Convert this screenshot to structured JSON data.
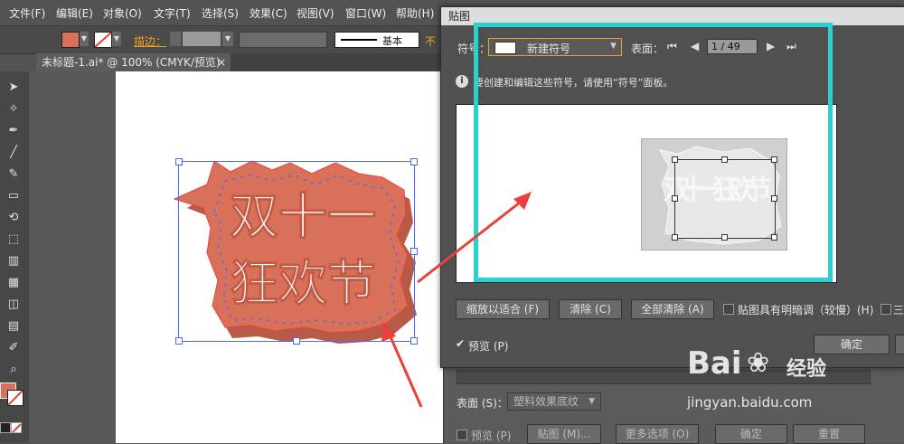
{
  "menu": [
    "文件(F)",
    "编辑(E)",
    "对象(O)",
    "文字(T)",
    "选择(S)",
    "效果(C)",
    "视图(V)",
    "窗口(W)",
    "帮助(H)"
  ],
  "control_bar": {
    "stroke_label": "描边：",
    "stroke_style": "基本",
    "extra": "不"
  },
  "document_tab": {
    "title": "未标题-1.ai* @ 100% (CMYK/预览)",
    "close": "×"
  },
  "artwork": {
    "line1": "双十一",
    "line2": "狂欢节",
    "fill_color": "#d9705a",
    "shadow_color": "#b85a48"
  },
  "dialog": {
    "title": "贴图",
    "symbol_label": "符号：",
    "symbol_value": "新建符号",
    "surface_label": "表面：",
    "page": "1 / 49",
    "info_icon": "i",
    "info_text": "要创建和编辑这些符号，请使用“符号”面板。",
    "preview_text": "双十一狂欢节",
    "buttons": {
      "fit": "缩放以适合 (F)",
      "clear": "清除 (C)",
      "clear_all": "全部清除 (A)"
    },
    "shade_checkbox": "贴图具有明暗调（较慢）(H)",
    "extra_check": "三",
    "preview_checkbox": "预览 (P)",
    "ok": "确定"
  },
  "back_dialog": {
    "surface_label": "表面 (S)：",
    "surface_value": "塑料效果底纹",
    "preview_checkbox": "预览 (P)",
    "map_button": "贴图 (M)...",
    "more_button": "更多选项 (O)",
    "ok": "确定",
    "reset": "重置"
  },
  "watermark": {
    "brand": "Bai",
    "brand2": "经验",
    "url": "jingyan.baidu.com"
  },
  "colors": {
    "highlight": "#2ad1d1",
    "arrow": "#e8403a",
    "selection": "#4a6cf0"
  }
}
